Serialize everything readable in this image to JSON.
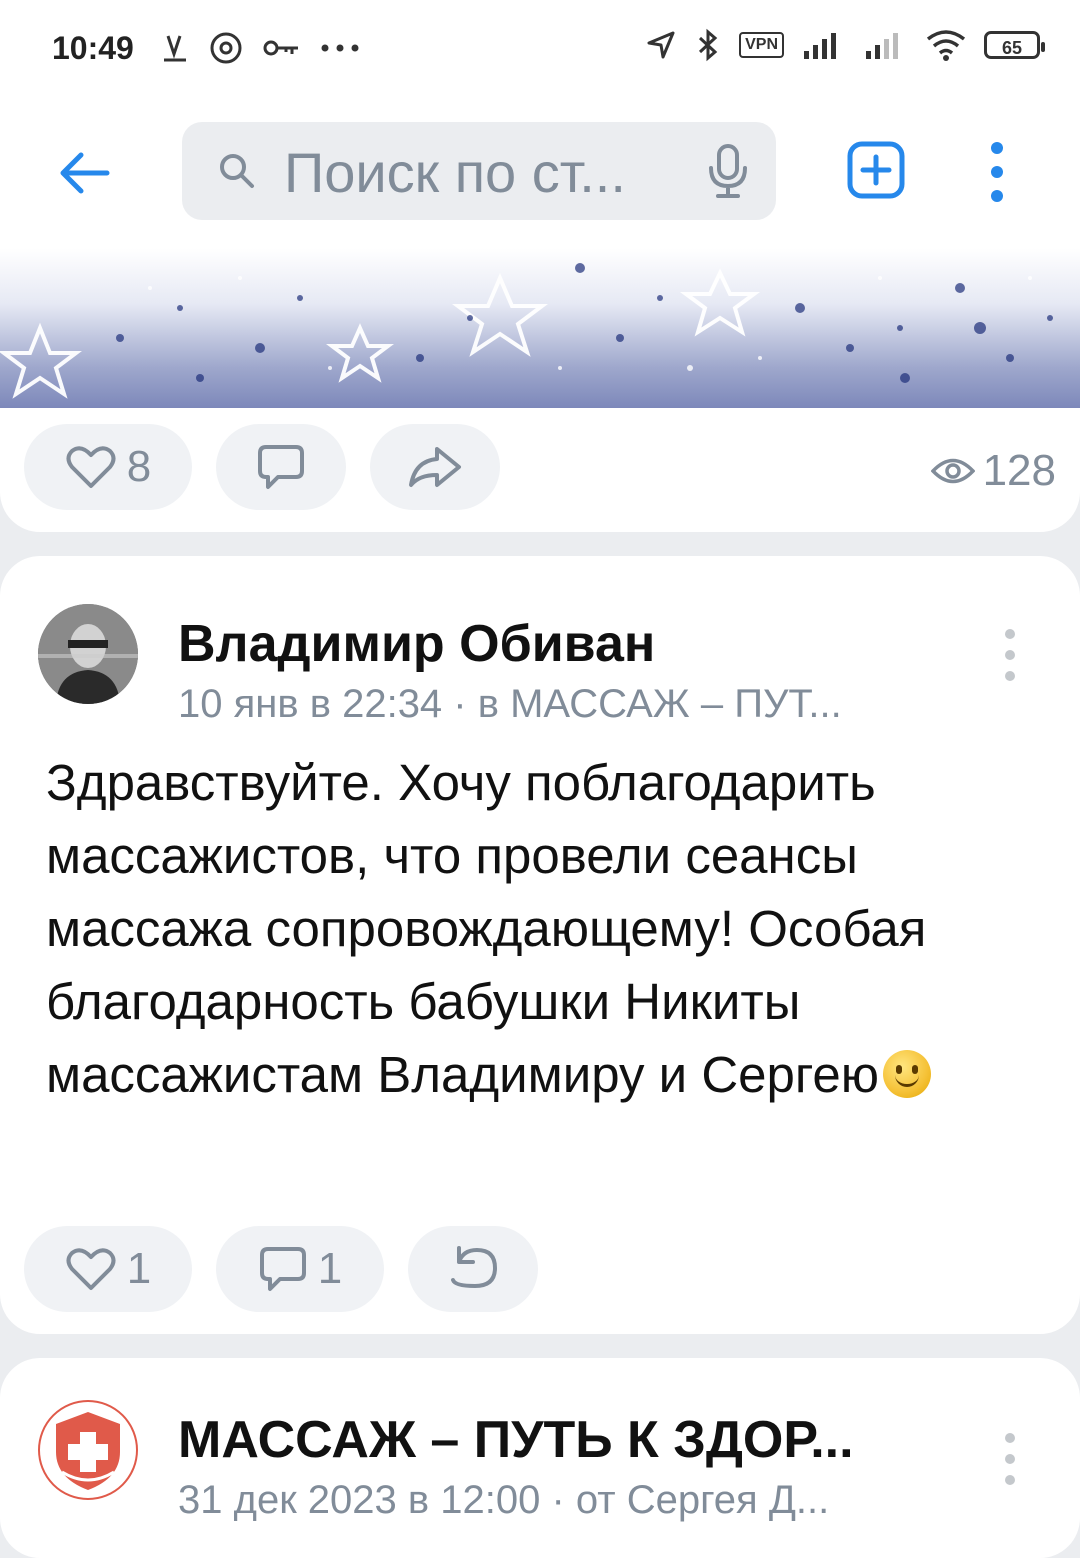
{
  "status_bar": {
    "time": "10:49",
    "vpn": "VPN",
    "battery": "65"
  },
  "search": {
    "placeholder": "Поиск по ст..."
  },
  "post1": {
    "likes": "8",
    "views": "128"
  },
  "post2": {
    "author": "Владимир Обиван",
    "meta": "10 янв в 22:34 · в МАССАЖ – ПУТ...",
    "text": "Здравствуйте. Хочу поблагодарить массажистов, что провели сеансы массажа сопровождающему! Особая благодарность бабушки Никиты массажистам Владимиру и Сергею",
    "likes": "1",
    "comments": "1"
  },
  "post3": {
    "author": "МАССАЖ – ПУТЬ К ЗДОР...",
    "meta": "31 дек 2023 в 12:00 · от Сергея Д..."
  },
  "colors": {
    "accent": "#2688eb",
    "secondary_text": "#818c99",
    "background": "#ebedf0"
  }
}
